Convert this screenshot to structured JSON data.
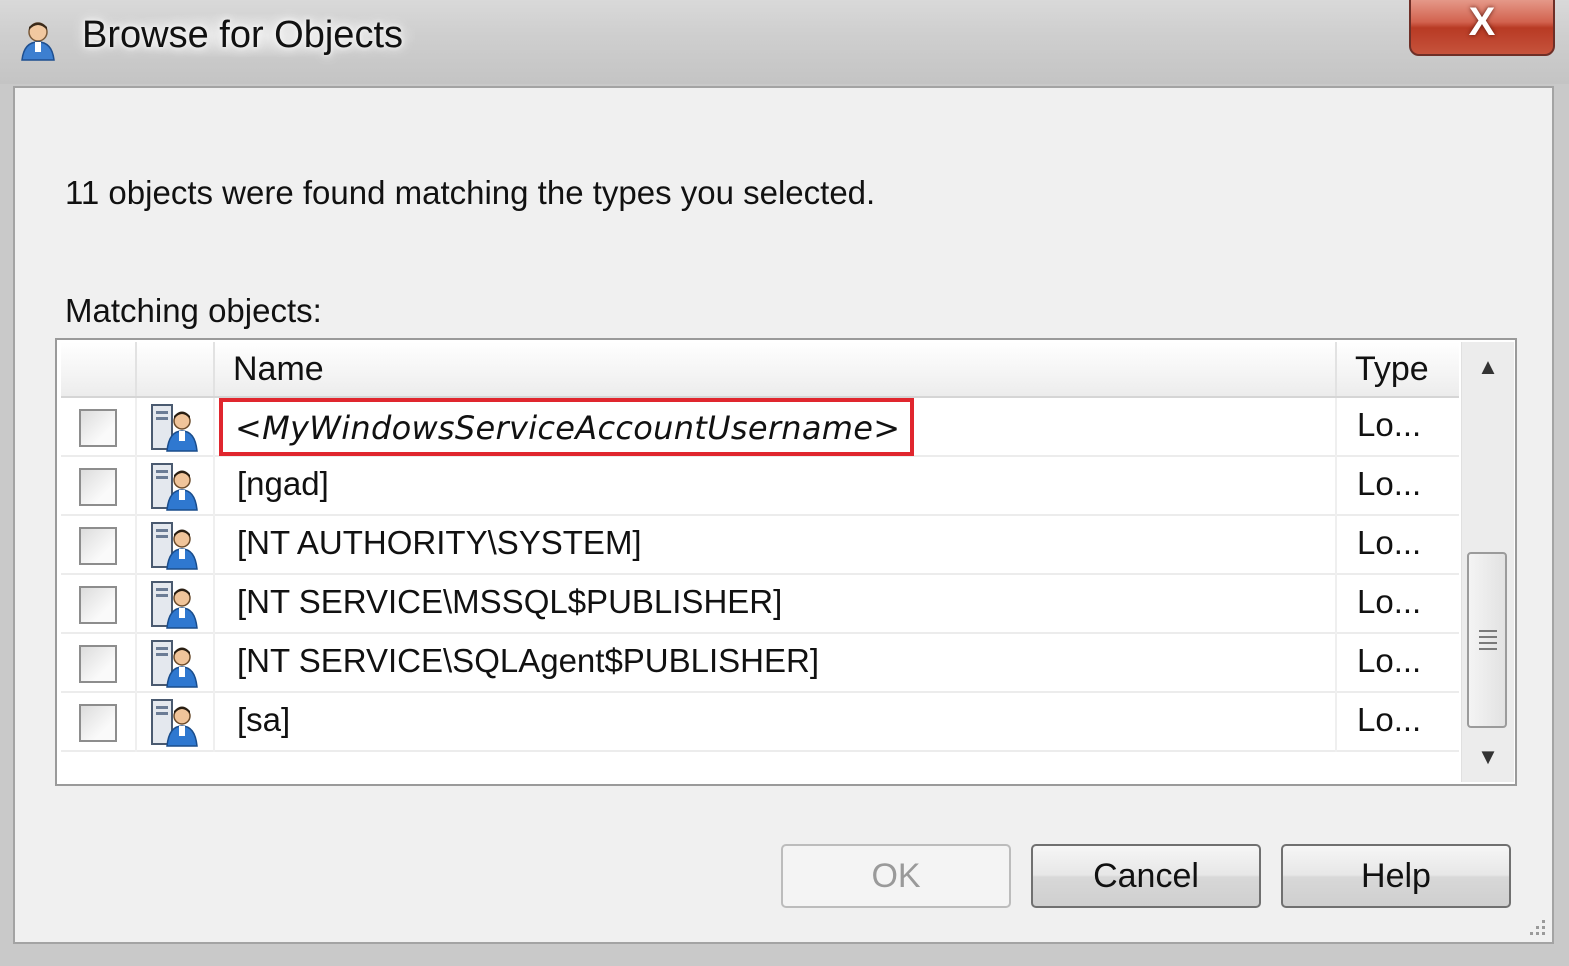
{
  "window": {
    "title": "Browse for Objects",
    "close_symbol": "X"
  },
  "summary_text": "11 objects were found matching the types you selected.",
  "matching_label": "Matching objects:",
  "table": {
    "columns": {
      "name": "Name",
      "type": "Type"
    },
    "rows": [
      {
        "name": "<MyWindowsServiceAccountUsername>",
        "type": "Lo...",
        "checked": false,
        "highlighted": true
      },
      {
        "name": "[ngad]",
        "type": "Lo...",
        "checked": false
      },
      {
        "name": "[NT AUTHORITY\\SYSTEM]",
        "type": "Lo...",
        "checked": false
      },
      {
        "name": "[NT SERVICE\\MSSQL$PUBLISHER]",
        "type": "Lo...",
        "checked": false
      },
      {
        "name": "[NT SERVICE\\SQLAgent$PUBLISHER]",
        "type": "Lo...",
        "checked": false
      },
      {
        "name": "[sa]",
        "type": "Lo...",
        "checked": false
      }
    ]
  },
  "buttons": {
    "ok": "OK",
    "cancel": "Cancel",
    "help": "Help"
  },
  "icons": {
    "title": "user-icon",
    "row": "login-user-icon",
    "scroll_up": "chevron-up-icon",
    "scroll_down": "chevron-down-icon"
  },
  "colors": {
    "highlight_border": "#e0262e",
    "close_button": "#c6533c"
  },
  "state": {
    "ok_enabled": false
  }
}
